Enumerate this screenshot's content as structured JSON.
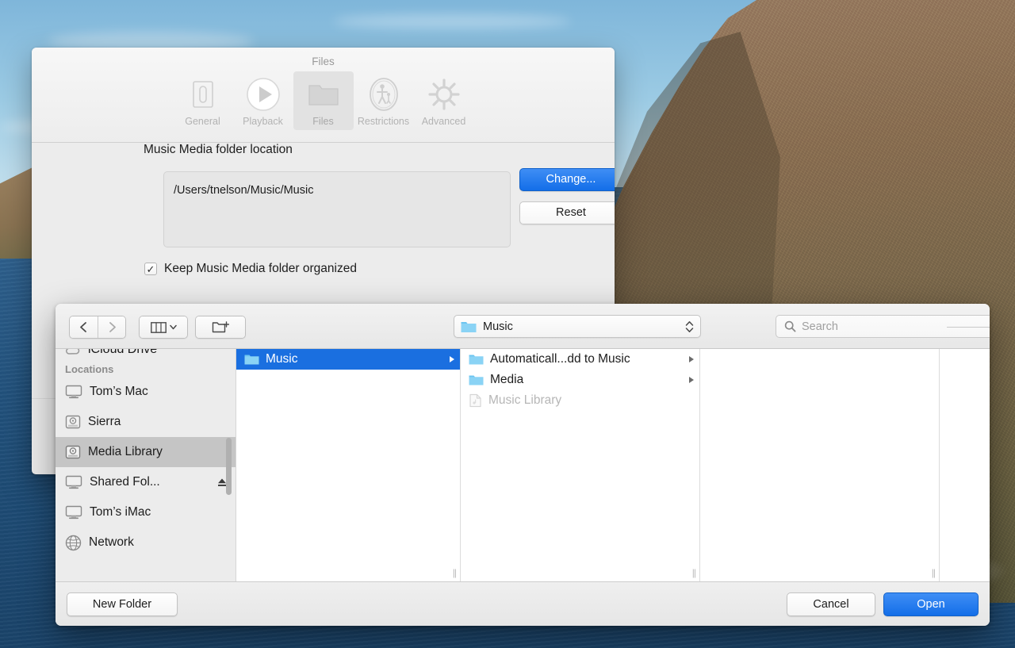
{
  "desktop": {
    "wallpaper_name": "mountain-coast-wallpaper"
  },
  "prefs_window": {
    "title": "Files",
    "tabs": [
      {
        "label": "General",
        "icon": "switch-icon",
        "active": false
      },
      {
        "label": "Playback",
        "icon": "play-circle-icon",
        "active": false
      },
      {
        "label": "Files",
        "icon": "folder-icon",
        "active": true
      },
      {
        "label": "Restrictions",
        "icon": "parental-icon",
        "active": false
      },
      {
        "label": "Advanced",
        "icon": "gear-icon",
        "active": false
      }
    ],
    "media_folder": {
      "section_label": "Music Media folder location",
      "path": "/Users/tnelson/Music/Music",
      "change_label": "Change...",
      "reset_label": "Reset"
    },
    "keep_organized": {
      "label": "Keep Music Media folder organized",
      "checked": true,
      "checkmark": "✓"
    }
  },
  "file_dialog": {
    "toolbar": {
      "back_icon": "chevron-left-icon",
      "forward_icon": "chevron-right-icon",
      "view_icon": "column-view-icon",
      "view_chevron_icon": "chevron-down-icon",
      "new_folder_icon": "new-folder-icon",
      "path_popup": {
        "label": "Music",
        "icon": "folder-icon",
        "stepper_icon": "up-down-stepper-icon"
      },
      "search": {
        "placeholder": "Search",
        "value": "",
        "icon": "search-icon"
      }
    },
    "sidebar": {
      "partial_top_item": {
        "label": "iCloud Drive",
        "icon": "cloud-icon"
      },
      "section_label": "Locations",
      "items": [
        {
          "label": "Tom’s Mac",
          "icon": "display-icon",
          "selected": false,
          "eject": false
        },
        {
          "label": "Sierra",
          "icon": "harddisk-icon",
          "selected": false,
          "eject": false
        },
        {
          "label": "Media Library",
          "icon": "harddisk-icon",
          "selected": true,
          "eject": false
        },
        {
          "label": "Shared Fol...",
          "icon": "display-icon",
          "selected": false,
          "eject": true,
          "eject_icon": "eject-icon"
        },
        {
          "label": "Tom’s iMac",
          "icon": "display-icon",
          "selected": false,
          "eject": false
        },
        {
          "label": "Network",
          "icon": "globe-icon",
          "selected": false,
          "eject": false
        }
      ]
    },
    "columns": [
      {
        "name": "column-1",
        "rows": [
          {
            "label": "Music",
            "icon": "folder-icon",
            "selected": true,
            "disclosure": true,
            "disabled": false,
            "arrow_icon": "disclosure-triangle-icon"
          }
        ]
      },
      {
        "name": "column-2",
        "rows": [
          {
            "label": "Automaticall...dd to Music",
            "icon": "folder-icon",
            "selected": false,
            "disclosure": true,
            "disabled": false,
            "arrow_icon": "disclosure-triangle-icon"
          },
          {
            "label": "Media",
            "icon": "folder-icon",
            "selected": false,
            "disclosure": true,
            "disabled": false,
            "arrow_icon": "disclosure-triangle-icon"
          },
          {
            "label": "Music Library",
            "icon": "document-icon",
            "selected": false,
            "disclosure": false,
            "disabled": true,
            "arrow_icon": ""
          }
        ]
      },
      {
        "name": "column-3",
        "rows": []
      },
      {
        "name": "column-4",
        "rows": []
      }
    ],
    "resize_grip_glyph": "||",
    "buttons": {
      "new_folder": "New Folder",
      "cancel": "Cancel",
      "open": "Open"
    }
  },
  "colors": {
    "accent_blue": "#136ee8",
    "selection_blue": "#1a6fe0",
    "sidebar_selection": "#c5c5c5",
    "folder_blue": "#6cc5f0",
    "window_gray": "#ececec"
  }
}
